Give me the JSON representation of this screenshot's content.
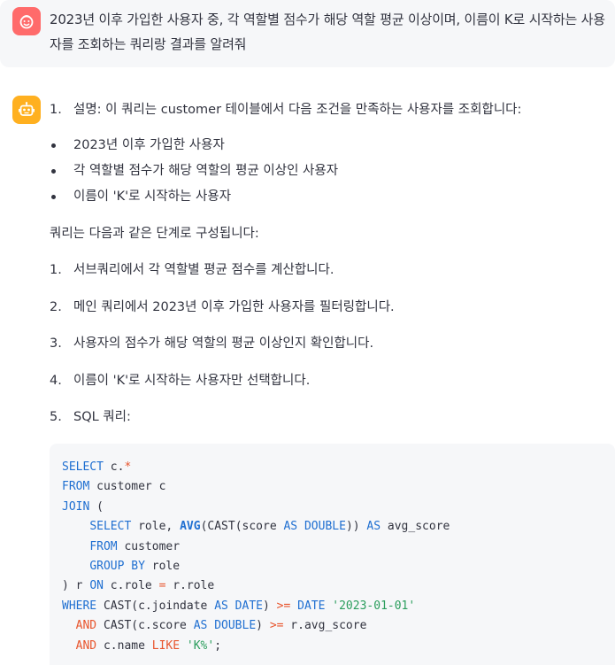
{
  "user_message": {
    "avatar_icon": "user-face-icon",
    "text": "2023년 이후 가입한 사용자 중, 각 역할별 점수가 해당 역할 평균 이상이며, 이름이 K로 시작하는 사용자를 조회하는 쿼리랑 결과를 알려줘"
  },
  "assistant_message": {
    "avatar_icon": "robot-icon",
    "intro_item": {
      "number": "1.",
      "text": "설명: 이 쿼리는 customer 테이블에서 다음 조건을 만족하는 사용자를 조회합니다:"
    },
    "conditions": [
      "2023년 이후 가입한 사용자",
      "각 역할별 점수가 해당 역할의 평균 이상인 사용자",
      "이름이 'K'로 시작하는 사용자"
    ],
    "steps_intro": "쿼리는 다음과 같은 단계로 구성됩니다:",
    "steps": [
      {
        "number": "1.",
        "text": "서브쿼리에서 각 역할별 평균 점수를 계산합니다."
      },
      {
        "number": "2.",
        "text": "메인 쿼리에서 2023년 이후 가입한 사용자를 필터링합니다."
      },
      {
        "number": "3.",
        "text": "사용자의 점수가 해당 역할의 평균 이상인지 확인합니다."
      },
      {
        "number": "4.",
        "text": "이름이 'K'로 시작하는 사용자만 선택합니다."
      },
      {
        "number": "5.",
        "text": "SQL 쿼리:"
      }
    ],
    "code": {
      "l1": {
        "kw": "SELECT",
        "a": " c.",
        "op": "*"
      },
      "l2": {
        "kw": "FROM",
        "a": " customer c"
      },
      "l3": {
        "kw": "JOIN",
        "a": " ("
      },
      "l4": {
        "indent": "    ",
        "kw": "SELECT",
        "a": " role, ",
        "fn": "AVG",
        "b": "(CAST(score ",
        "kw2": "AS DOUBLE",
        "c": ")) ",
        "kw3": "AS",
        "d": " avg_score"
      },
      "l5": {
        "indent": "    ",
        "kw": "FROM",
        "a": " customer"
      },
      "l6": {
        "indent": "    ",
        "kw": "GROUP BY",
        "a": " role"
      },
      "l7": {
        "a": ") r ",
        "kw": "ON",
        "b": " c.role ",
        "op": "=",
        "c": " r.role"
      },
      "l8": {
        "kw": "WHERE",
        "a": " CAST(c.joindate ",
        "kw2": "AS DATE",
        "b": ") ",
        "op": ">=",
        "c": " ",
        "kw3": "DATE",
        "d": " ",
        "str": "'2023-01-01'"
      },
      "l9": {
        "indent": "  ",
        "kw": "AND",
        "a": " CAST(c.score ",
        "kw2": "AS DOUBLE",
        "b": ") ",
        "op": ">=",
        "c": " r.avg_score"
      },
      "l10": {
        "indent": "  ",
        "kw": "AND",
        "a": " c.name ",
        "kw2": "LIKE",
        "b": " ",
        "str": "'K%'",
        "c": ";"
      }
    },
    "colors": {
      "keyword": "#1f6fd1",
      "operator": "#e8552d",
      "string": "#2a9d5c"
    }
  }
}
